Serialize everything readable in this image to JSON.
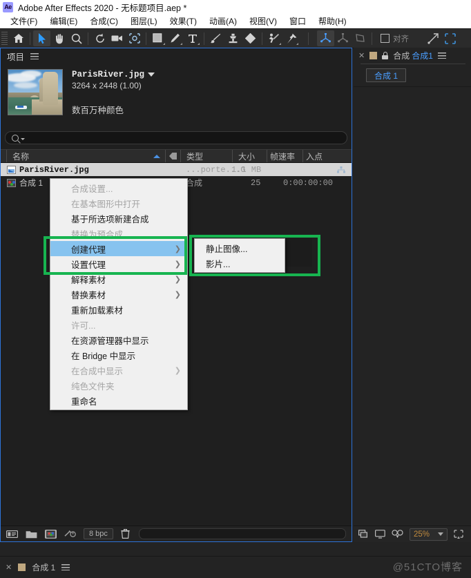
{
  "window": {
    "app_badge": "Ae",
    "title": "Adobe After Effects 2020 - 无标题项目.aep *"
  },
  "menubar": {
    "items": [
      {
        "label": "文件(F)"
      },
      {
        "label": "编辑(E)"
      },
      {
        "label": "合成(C)"
      },
      {
        "label": "图层(L)"
      },
      {
        "label": "效果(T)"
      },
      {
        "label": "动画(A)"
      },
      {
        "label": "视图(V)"
      },
      {
        "label": "窗口"
      },
      {
        "label": "帮助(H)"
      }
    ]
  },
  "toolbar": {
    "align_label": "对齐",
    "tools": [
      {
        "name": "home-icon",
        "selected": false
      },
      {
        "name": "selection-tool-icon",
        "selected": true
      },
      {
        "name": "hand-tool-icon",
        "selected": false
      },
      {
        "name": "zoom-tool-icon",
        "selected": false
      },
      {
        "name": "rotation-tool-icon",
        "selected": false
      },
      {
        "name": "camera-tool-icon",
        "selected": false
      },
      {
        "name": "pan-behind-tool-icon",
        "selected": false
      },
      {
        "name": "shape-tool-icon",
        "selected": false
      },
      {
        "name": "pen-tool-icon",
        "selected": false
      },
      {
        "name": "type-tool-icon",
        "selected": false
      },
      {
        "name": "brush-tool-icon",
        "selected": false
      },
      {
        "name": "clone-stamp-tool-icon",
        "selected": false
      },
      {
        "name": "eraser-tool-icon",
        "selected": false
      },
      {
        "name": "roto-brush-tool-icon",
        "selected": false
      },
      {
        "name": "puppet-pin-tool-icon",
        "selected": false
      }
    ]
  },
  "project_panel": {
    "title": "项目",
    "preview": {
      "filename": "ParisRiver.jpg",
      "dimensions": "3264 x 2448 (1.00)",
      "colors": "数百万种颜色"
    },
    "search": {
      "value": "",
      "placeholder": ""
    },
    "columns": [
      {
        "label": "名称"
      },
      {
        "label": "类型"
      },
      {
        "label": "大小"
      },
      {
        "label": "帧速率"
      },
      {
        "label": "入点"
      }
    ],
    "rows": [
      {
        "icon": "jpeg-file-icon",
        "name": "ParisRiver.jpg",
        "type": "...porte...G",
        "size": "1.1 MB",
        "framerate": "",
        "in_point": "",
        "selected": true
      },
      {
        "icon": "composition-icon",
        "name": "合成 1",
        "type": "合成",
        "size": "",
        "framerate": "25",
        "in_point": "0:00:00:00",
        "selected": false
      }
    ],
    "footer": {
      "bit_depth": "8 bpc",
      "buttons": [
        {
          "name": "interpret-footage-icon"
        },
        {
          "name": "new-folder-icon"
        },
        {
          "name": "new-composition-icon"
        },
        {
          "name": "project-settings-icon"
        },
        {
          "name": "delete-icon"
        }
      ]
    }
  },
  "composition_panel": {
    "tab_prefix": "合成",
    "tab_name": "合成1",
    "chip_label": "合成 1",
    "footer": {
      "zoom": "25%",
      "buttons": [
        {
          "name": "render-queue-icon"
        },
        {
          "name": "monitor-icon"
        },
        {
          "name": "3d-glasses-icon"
        },
        {
          "name": "region-of-interest-icon"
        }
      ]
    }
  },
  "timeline": {
    "tab_name": "合成 1"
  },
  "context_menu": {
    "items": [
      {
        "label": "合成设置...",
        "disabled": true,
        "submenu": false,
        "highlighted": false
      },
      {
        "label": "在基本图形中打开",
        "disabled": true,
        "submenu": false,
        "highlighted": false
      },
      {
        "label": "基于所选项新建合成",
        "disabled": false,
        "submenu": false,
        "highlighted": false
      },
      {
        "label": "替换为预合成",
        "disabled": true,
        "submenu": false,
        "highlighted": false
      },
      {
        "label": "创建代理",
        "disabled": false,
        "submenu": true,
        "highlighted": true
      },
      {
        "label": "设置代理",
        "disabled": false,
        "submenu": true,
        "highlighted": false
      },
      {
        "label": "解释素材",
        "disabled": false,
        "submenu": true,
        "highlighted": false
      },
      {
        "label": "替换素材",
        "disabled": false,
        "submenu": true,
        "highlighted": false
      },
      {
        "label": "重新加载素材",
        "disabled": false,
        "submenu": false,
        "highlighted": false
      },
      {
        "label": "许可...",
        "disabled": true,
        "submenu": false,
        "highlighted": false
      },
      {
        "label": "在资源管理器中显示",
        "disabled": false,
        "submenu": false,
        "highlighted": false
      },
      {
        "label": "在 Bridge 中显示",
        "disabled": false,
        "submenu": false,
        "highlighted": false
      },
      {
        "label": "在合成中显示",
        "disabled": true,
        "submenu": true,
        "highlighted": false
      },
      {
        "label": "纯色文件夹",
        "disabled": true,
        "submenu": false,
        "highlighted": false
      },
      {
        "label": "重命名",
        "disabled": false,
        "submenu": false,
        "highlighted": false
      }
    ]
  },
  "submenu": {
    "items": [
      {
        "label": "静止图像..."
      },
      {
        "label": "影片..."
      }
    ]
  },
  "annotations": {
    "highlight_color": "#17b450",
    "highlight_boxes": [
      "create-proxy-set-proxy",
      "proxy-submenu"
    ]
  },
  "watermark": {
    "text": "@51CTO博客"
  },
  "colors": {
    "accent_blue": "#4a9eff",
    "selection_blue": "#87c3ef",
    "panel_border_blue": "#2d74da",
    "zoom_orange": "#c08a3e",
    "highlight_green": "#17b450"
  }
}
